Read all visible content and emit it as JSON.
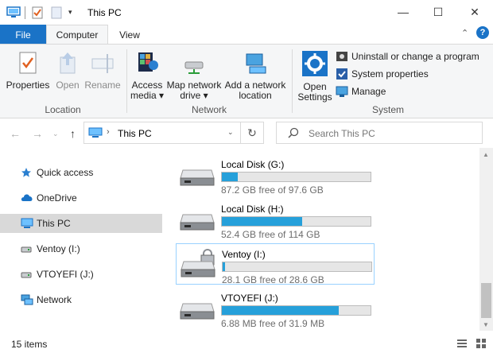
{
  "window": {
    "title": "This PC"
  },
  "ribbon_tabs": {
    "file": "File",
    "computer": "Computer",
    "view": "View"
  },
  "ribbon": {
    "location": {
      "label": "Location",
      "properties": "Properties",
      "open": "Open",
      "rename": "Rename"
    },
    "network": {
      "label": "Network",
      "access_media_line1": "Access",
      "access_media_line2": "media",
      "map_drive_line1": "Map network",
      "map_drive_line2": "drive",
      "add_location_line1": "Add a network",
      "add_location_line2": "location"
    },
    "system": {
      "label": "System",
      "open_settings_line1": "Open",
      "open_settings_line2": "Settings",
      "uninstall": "Uninstall or change a program",
      "system_properties": "System properties",
      "manage": "Manage"
    },
    "help": "?"
  },
  "address": {
    "path": "This PC",
    "search_placeholder": "Search This PC"
  },
  "sidebar": {
    "items": [
      {
        "label": "Quick access",
        "icon": "star-icon"
      },
      {
        "label": "OneDrive",
        "icon": "cloud-icon"
      },
      {
        "label": "This PC",
        "icon": "computer-icon"
      },
      {
        "label": "Ventoy (I:)",
        "icon": "drive-icon"
      },
      {
        "label": "VTOYEFI (J:)",
        "icon": "drive-icon"
      },
      {
        "label": "Network",
        "icon": "network-icon"
      }
    ]
  },
  "drives": [
    {
      "name": "Local Disk (G:)",
      "free": "87.2 GB free of 97.6 GB",
      "used_fraction": 0.107,
      "locked": false
    },
    {
      "name": "Local Disk (H:)",
      "free": "52.4 GB free of 114 GB",
      "used_fraction": 0.54,
      "locked": false
    },
    {
      "name": "Ventoy (I:)",
      "free": "28.1 GB free of 28.6 GB",
      "used_fraction": 0.017,
      "locked": true
    },
    {
      "name": "VTOYEFI (J:)",
      "free": "6.88 MB free of 31.9 MB",
      "used_fraction": 0.784,
      "locked": false
    }
  ],
  "status": {
    "count": "15 items"
  },
  "colors": {
    "accent": "#1a73c7",
    "bar_fill": "#26a0da",
    "selected_bg": "#d9d9d9"
  }
}
